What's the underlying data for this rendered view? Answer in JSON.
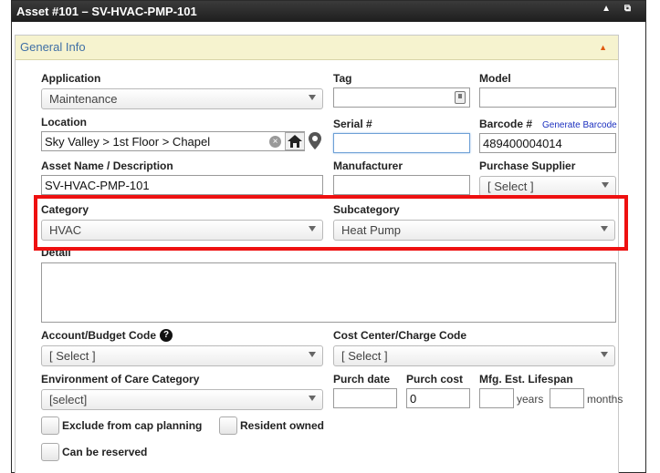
{
  "window": {
    "title": "Asset #101 – SV-HVAC-PMP-101",
    "icons": "▲ ⧉"
  },
  "panel": {
    "title": "General Info",
    "collapse_icon": "▲"
  },
  "application": {
    "label": "Application",
    "value": "Maintenance"
  },
  "tag": {
    "label": "Tag",
    "value": ""
  },
  "model": {
    "label": "Model",
    "value": ""
  },
  "location": {
    "label": "Location",
    "value": "Sky Valley > 1st Floor > Chapel"
  },
  "serial": {
    "label": "Serial #",
    "value": ""
  },
  "barcode": {
    "label": "Barcode #",
    "generate_link": "Generate Barcode",
    "value": "489400004014"
  },
  "asset_name": {
    "label": "Asset Name / Description",
    "value": "SV-HVAC-PMP-101"
  },
  "manufacturer": {
    "label": "Manufacturer",
    "value": ""
  },
  "purchase_supplier": {
    "label": "Purchase Supplier",
    "value": "[ Select ]"
  },
  "category": {
    "label": "Category",
    "value": "HVAC"
  },
  "subcategory": {
    "label": "Subcategory",
    "value": "Heat Pump"
  },
  "detail": {
    "label": "Detail",
    "value": ""
  },
  "account_code": {
    "label": "Account/Budget Code",
    "help": "?",
    "value": "[ Select ]"
  },
  "cost_center": {
    "label": "Cost Center/Charge Code",
    "value": "[ Select ]"
  },
  "env_care": {
    "label": "Environment of Care Category",
    "value": "[select]"
  },
  "purch_date": {
    "label": "Purch date",
    "value": ""
  },
  "purch_cost": {
    "label": "Purch cost",
    "value": "0"
  },
  "lifespan": {
    "label": "Mfg. Est. Lifespan",
    "years_unit": "years",
    "months_unit": "months",
    "years": "",
    "months": ""
  },
  "checkboxes": {
    "exclude_cap": "Exclude from cap planning",
    "resident_owned": "Resident owned",
    "can_reserve": "Can be reserved"
  },
  "colors": {
    "highlight": "#ee1010",
    "panel_title": "#3f6fa6",
    "panel_bg": "#f6f3cf"
  }
}
